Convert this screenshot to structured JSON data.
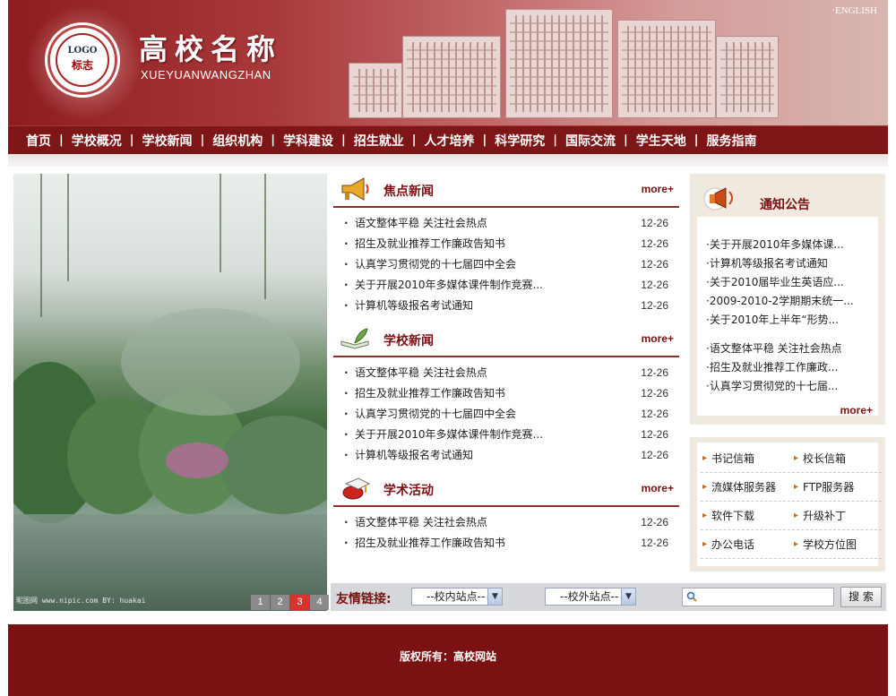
{
  "header": {
    "logo_text": "LOGO",
    "logo_sub": "标志",
    "site_title": "高校名称",
    "site_subtitle": "XUEYUANWANGZHAN",
    "english_link": "·ENGLISH"
  },
  "nav": {
    "items": [
      "首页",
      "学校概况",
      "学校新闻",
      "组织机构",
      "学科建设",
      "招生就业",
      "人才培养",
      "科学研究",
      "国际交流",
      "学生天地",
      "服务指南"
    ],
    "separator": "|"
  },
  "photo": {
    "credit": "昵图网 www.nipic.com   BY: huakai",
    "pager": [
      "1",
      "2",
      "3",
      "4"
    ],
    "active_page": "3"
  },
  "focus_news": {
    "title": "焦点新闻",
    "more": "more+",
    "items": [
      {
        "title": "语文整体平稳 关注社会热点",
        "date": "12-26"
      },
      {
        "title": "招生及就业推荐工作廉政告知书",
        "date": "12-26"
      },
      {
        "title": "认真学习贯彻党的十七届四中全会",
        "date": "12-26"
      },
      {
        "title": "关于开展2010年多媒体课件制作竞赛...",
        "date": "12-26"
      },
      {
        "title": "计算机等级报名考试通知",
        "date": "12-26"
      }
    ]
  },
  "school_news": {
    "title": "学校新闻",
    "more": "more+",
    "items": [
      {
        "title": "语文整体平稳 关注社会热点",
        "date": "12-26"
      },
      {
        "title": "招生及就业推荐工作廉政告知书",
        "date": "12-26"
      },
      {
        "title": "认真学习贯彻党的十七届四中全会",
        "date": "12-26"
      },
      {
        "title": "关于开展2010年多媒体课件制作竞赛...",
        "date": "12-26"
      },
      {
        "title": "计算机等级报名考试通知",
        "date": "12-26"
      }
    ]
  },
  "academic": {
    "title": "学术活动",
    "more": "more+",
    "items": [
      {
        "title": "语文整体平稳 关注社会热点",
        "date": "12-26"
      },
      {
        "title": "招生及就业推荐工作廉政告知书",
        "date": "12-26"
      }
    ]
  },
  "notice": {
    "title": "通知公告",
    "more": "more+",
    "items": [
      "·关于开展2010年多媒体课...",
      "·计算机等级报名考试通知",
      "·关于2010届毕业生英语应...",
      "·2009-2010-2学期期末统一...",
      "·关于2010年上半年“形势..."
    ],
    "items2": [
      "·语文整体平稳 关注社会热点",
      "·招生及就业推荐工作廉政...",
      "·认真学习贯彻党的十七届..."
    ]
  },
  "quick_links": [
    "书记信箱",
    "校长信箱",
    "流媒体服务器",
    "FTP服务器",
    "软件下载",
    "升级补丁",
    "办公电话",
    "学校方位图"
  ],
  "friend_links": {
    "label": "友情链接:",
    "inner_select": "--校内站点--",
    "outer_select": "--校外站点--",
    "search_placeholder": "",
    "search_button": "搜 索"
  },
  "footer": {
    "copyright": "版权所有：高校网站"
  },
  "colors": {
    "brand": "#7a1112",
    "accent_more": "#7a1112",
    "pager_active": "#d8342c"
  }
}
